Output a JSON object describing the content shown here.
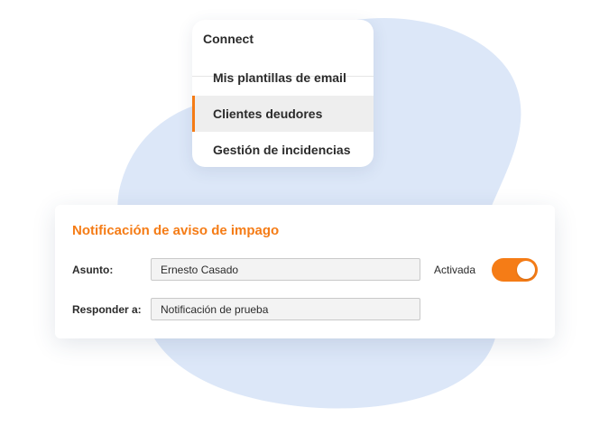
{
  "menu": {
    "title": "Connect",
    "items": [
      {
        "label": "Mis plantillas de email"
      },
      {
        "label": "Clientes deudores"
      },
      {
        "label": "Gestión de incidencias"
      }
    ],
    "active_index": 1
  },
  "form": {
    "title": "Notificación de aviso de impago",
    "subject_label": "Asunto:",
    "subject_value": "Ernesto Casado",
    "reply_label": "Responder a:",
    "reply_value": "Notificación de prueba",
    "toggle_label": "Activada",
    "toggle_on": true
  },
  "colors": {
    "accent": "#f57c16",
    "blob": "#dce7f8"
  }
}
